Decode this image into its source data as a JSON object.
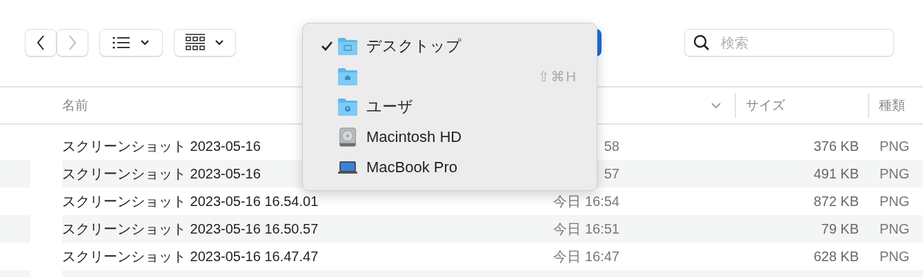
{
  "toolbar": {
    "back": {
      "disabled": false
    },
    "forward": {
      "disabled": true
    },
    "search": {
      "placeholder": "検索"
    }
  },
  "table": {
    "columns": [
      "名前",
      "サイズ",
      "種類"
    ],
    "rows": [
      {
        "name": "スクリーンショット 2023-05-16",
        "date": "58",
        "size": "376 KB",
        "kind": "PNG"
      },
      {
        "name": "スクリーンショット 2023-05-16",
        "date": "57",
        "size": "491 KB",
        "kind": "PNG"
      },
      {
        "name": "スクリーンショット 2023-05-16 16.54.01",
        "date": "今日 16:54",
        "size": "872 KB",
        "kind": "PNG"
      },
      {
        "name": "スクリーンショット 2023-05-16 16.50.57",
        "date": "今日 16:51",
        "size": "79 KB",
        "kind": "PNG"
      },
      {
        "name": "スクリーンショット 2023-05-16 16.47.47",
        "date": "今日 16:47",
        "size": "628 KB",
        "kind": "PNG"
      }
    ]
  },
  "menu": {
    "items": [
      {
        "kind": "desktop",
        "label": "デスクトップ",
        "checked": true
      },
      {
        "kind": "home",
        "shortcut": "⇧⌘H",
        "checked": false
      },
      {
        "kind": "user",
        "label": "ユーザ",
        "checked": false
      },
      {
        "kind": "disk",
        "label": "Macintosh HD",
        "checked": false
      },
      {
        "kind": "computer",
        "label": "MacBook Pro",
        "checked": false
      }
    ]
  }
}
